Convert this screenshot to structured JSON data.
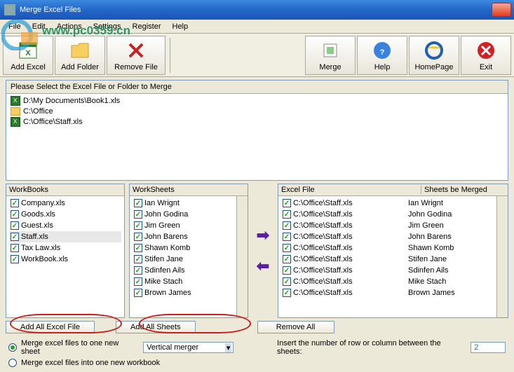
{
  "window": {
    "title": "Merge Excel Files"
  },
  "menu": {
    "file": "File",
    "edit": "Edit",
    "actions": "Actions",
    "settings": "Settings",
    "register": "Register",
    "help": "Help"
  },
  "toolbar": {
    "add_excel": "Add Excel",
    "add_folder": "Add Folder",
    "remove_file": "Remove File",
    "merge": "Merge",
    "help": "Help",
    "homepage": "HomePage",
    "exit": "Exit"
  },
  "filebox": {
    "header": "Please Select the Excel File or Folder to Merge",
    "items": [
      {
        "type": "xl",
        "path": "D:\\My Documents\\Book1.xls"
      },
      {
        "type": "fld",
        "path": "C:\\Office"
      },
      {
        "type": "xl",
        "path": "C:\\Office\\Staff.xls"
      }
    ]
  },
  "workbooks": {
    "title": "WorkBooks",
    "items": [
      "Company.xls",
      "Goods.xls",
      "Guest.xls",
      "Staff.xls",
      "Tax Law.xls",
      "WorkBook.xls"
    ],
    "selected_index": 3
  },
  "worksheets": {
    "title": "WorkSheets",
    "items": [
      "Ian Wrignt",
      "John Godina",
      "Jim Green",
      "John Barens",
      "Shawn Komb",
      "Stifen Jane",
      "Sdinfen Ails",
      "Mike Stach",
      "Brown James"
    ]
  },
  "mergetable": {
    "col1": "Excel File",
    "col2": "Sheets be Merged",
    "rows": [
      {
        "f": "C:\\Office\\Staff.xls",
        "s": "Ian Wrignt"
      },
      {
        "f": "C:\\Office\\Staff.xls",
        "s": "John Godina"
      },
      {
        "f": "C:\\Office\\Staff.xls",
        "s": "Jim Green"
      },
      {
        "f": "C:\\Office\\Staff.xls",
        "s": "John Barens"
      },
      {
        "f": "C:\\Office\\Staff.xls",
        "s": "Shawn Komb"
      },
      {
        "f": "C:\\Office\\Staff.xls",
        "s": "Stifen Jane"
      },
      {
        "f": "C:\\Office\\Staff.xls",
        "s": "Sdinfen Ails"
      },
      {
        "f": "C:\\Office\\Staff.xls",
        "s": "Mike Stach"
      },
      {
        "f": "C:\\Office\\Staff.xls",
        "s": "Brown James"
      }
    ]
  },
  "buttons": {
    "add_all_excel": "Add All Excel File",
    "add_all_sheets": "Add All Sheets",
    "remove_all": "Remove All"
  },
  "options": {
    "opt1": "Merge excel files to one new sheet",
    "opt2": "Merge excel files into one new workbook",
    "select_val": "Vertical merger",
    "row_label": "Insert the number of row or column between the sheets:",
    "row_val": "2"
  },
  "watermark": "www.pc0359.cn"
}
